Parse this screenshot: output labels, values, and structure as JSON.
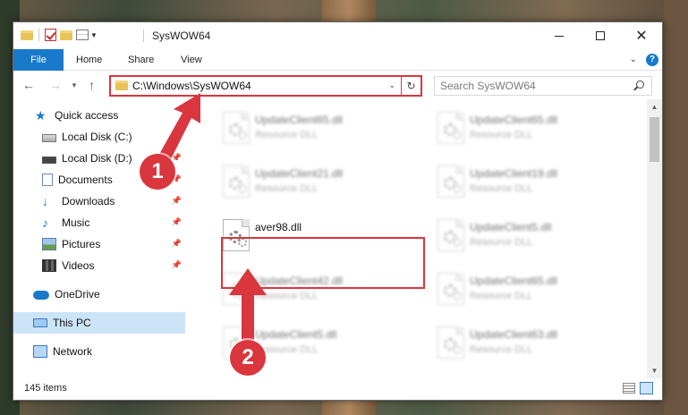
{
  "window": {
    "title": "SysWOW64",
    "min_glyph": "",
    "close_glyph": "✕"
  },
  "ribbon": {
    "tabs": [
      "File",
      "Home",
      "Share",
      "View"
    ],
    "help": "?"
  },
  "navbar": {
    "address": "C:\\Windows\\SysWOW64",
    "search_placeholder": "Search SysWOW64"
  },
  "sidebar": {
    "items": [
      {
        "label": "Quick access",
        "icon": "star-icon"
      },
      {
        "label": "Local Disk (C:)",
        "icon": "drive-icon"
      },
      {
        "label": "Local Disk (D:)",
        "icon": "drive-icon"
      },
      {
        "label": "Documents",
        "icon": "document-icon"
      },
      {
        "label": "Downloads",
        "icon": "download-icon"
      },
      {
        "label": "Music",
        "icon": "music-icon"
      },
      {
        "label": "Pictures",
        "icon": "pictures-icon"
      },
      {
        "label": "Videos",
        "icon": "videos-icon"
      },
      {
        "label": "OneDrive",
        "icon": "cloud-icon"
      },
      {
        "label": "This PC",
        "icon": "computer-icon"
      },
      {
        "label": "Network",
        "icon": "network-icon"
      }
    ]
  },
  "files": [
    {
      "name": "UpdateClient65.dll",
      "type": "Resource DLL"
    },
    {
      "name": "UpdateClient65.dll",
      "type": "Resource DLL"
    },
    {
      "name": "UpdateClient21.dll",
      "type": "Resource DLL"
    },
    {
      "name": "UpdateClient19.dll",
      "type": "Resource DLL"
    },
    {
      "name": "aver98.dll",
      "type": ""
    },
    {
      "name": "UpdateClient5.dll",
      "type": "Resource DLL"
    },
    {
      "name": "UpdateClient42.dll",
      "type": "Resource DLL"
    },
    {
      "name": "UpdateClient65.dll",
      "type": "Resource DLL"
    },
    {
      "name": "UpdateClient5.dll",
      "type": "Resource DLL"
    },
    {
      "name": "UpdateClient63.dll",
      "type": "Resource DLL"
    }
  ],
  "status": {
    "count": "145 items"
  },
  "annotations": {
    "step1": "1",
    "step2": "2",
    "color": "#d9363e"
  }
}
